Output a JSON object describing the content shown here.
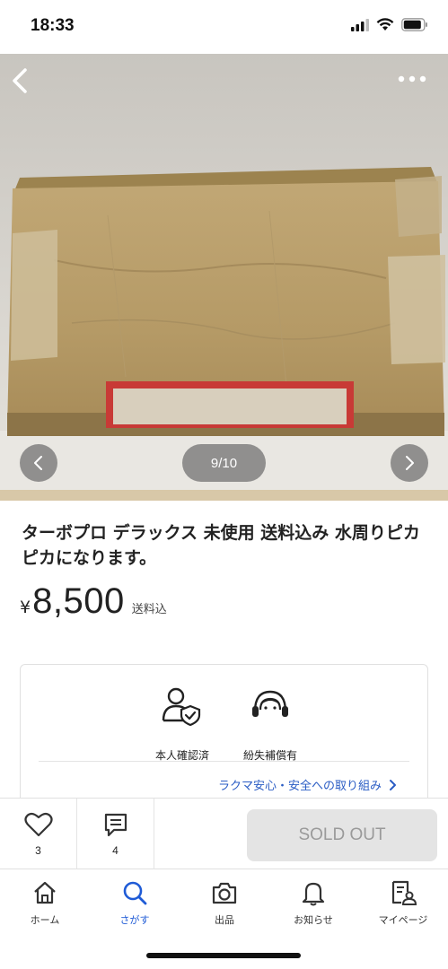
{
  "status": {
    "time": "18:33"
  },
  "icons": {
    "back": "chevron-left-icon",
    "more": "more-dots-icon",
    "prev": "chevron-left-icon",
    "next": "chevron-right-icon",
    "verify": "id-verified-icon",
    "support": "support-headset-icon",
    "like": "heart-icon",
    "comment": "comment-icon",
    "home": "home-icon",
    "search": "search-icon",
    "camera": "camera-icon",
    "bell": "bell-icon",
    "mypage": "profile-doc-icon"
  },
  "gallery": {
    "counter": "9/10"
  },
  "product": {
    "title": "ターボプロ デラックス 未使用 送料込み 水周りピカピカになります。",
    "currency": "¥",
    "price": "8,500",
    "price_note": "送料込"
  },
  "safety": {
    "items": [
      {
        "label": "本人確認済"
      },
      {
        "label": "紛失補償有"
      }
    ],
    "link": "ラクマ安心・安全への取り組み"
  },
  "actions": {
    "like_count": "3",
    "comment_count": "4",
    "status_button": "SOLD OUT"
  },
  "tabs": [
    {
      "label": "ホーム"
    },
    {
      "label": "さがす"
    },
    {
      "label": "出品"
    },
    {
      "label": "お知らせ"
    },
    {
      "label": "マイページ"
    }
  ],
  "colors": {
    "accent": "#1f5bd6",
    "link": "#2a5cc4",
    "sold_out_bg": "#e4e4e4"
  }
}
